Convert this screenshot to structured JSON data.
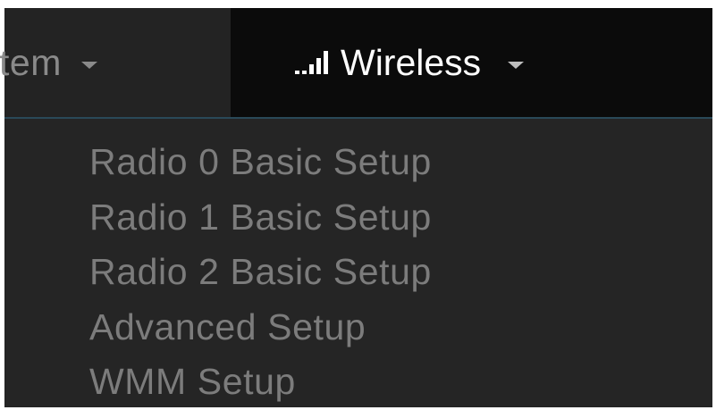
{
  "navbar": {
    "system_label": "tem",
    "wireless_label": "Wireless"
  },
  "icons": {
    "signal": "signal-bars-icon",
    "caret": "caret-down-icon"
  },
  "dropdown": {
    "items": [
      {
        "label": "Radio 0 Basic Setup"
      },
      {
        "label": "Radio 1 Basic Setup"
      },
      {
        "label": "Radio 2 Basic Setup"
      },
      {
        "label": "Advanced Setup"
      },
      {
        "label": "WMM Setup"
      }
    ]
  },
  "colors": {
    "navbar_bg": "#0b0b0b",
    "inactive_tab_bg": "#232323",
    "dropdown_bg": "#252525",
    "menu_text": "#7c7c7c",
    "active_text": "#ffffff"
  }
}
